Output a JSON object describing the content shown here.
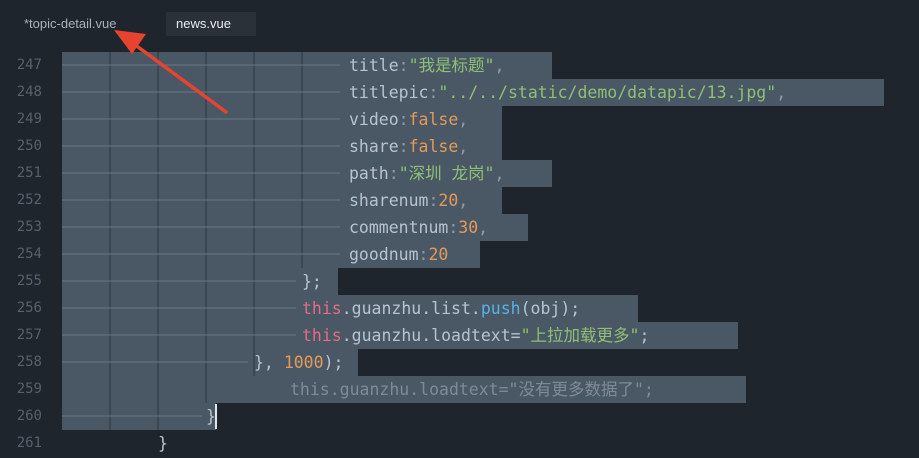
{
  "tabs": [
    {
      "label": "*topic-detail.vue",
      "active": false
    },
    {
      "label": "news.vue",
      "active": true
    }
  ],
  "line_numbers": [
    "247",
    "248",
    "249",
    "250",
    "251",
    "252",
    "253",
    "254",
    "255",
    "256",
    "257",
    "258",
    "259",
    "260",
    "261"
  ],
  "code": {
    "l247": {
      "key": "title",
      "colon": ":",
      "str": "\"我是标题\"",
      "end": ","
    },
    "l248": {
      "key": "titlepic",
      "colon": ":",
      "str": "\"../../static/demo/datapic/13.jpg\"",
      "end": ","
    },
    "l249": {
      "key": "video",
      "colon": ":",
      "val": "false",
      "end": ","
    },
    "l250": {
      "key": "share",
      "colon": ":",
      "val": "false",
      "end": ","
    },
    "l251": {
      "key": "path",
      "colon": ":",
      "str": "\"深圳 龙岗\"",
      "end": ","
    },
    "l252": {
      "key": "sharenum",
      "colon": ":",
      "val": "20",
      "end": ","
    },
    "l253": {
      "key": "commentnum",
      "colon": ":",
      "val": "30",
      "end": ","
    },
    "l254": {
      "key": "goodnum",
      "colon": ":",
      "val": "20"
    },
    "l255": {
      "text": "};"
    },
    "l256": {
      "this": "this",
      "rest1": ".guanzhu.list.",
      "fn": "push",
      "rest2": "(obj);"
    },
    "l257": {
      "this": "this",
      "rest1": ".guanzhu.loadtext=",
      "str": "\"上拉加载更多\"",
      "end": ";"
    },
    "l258": {
      "pre": "}, ",
      "num": "1000",
      "end": ");"
    },
    "l259": {
      "text": "this.guanzhu.loadtext=\"没有更多数据了\";"
    },
    "l260": {
      "text": "}"
    },
    "l261": {
      "text": "}"
    }
  },
  "colors": {
    "background": "#1e252c",
    "selection": "#4a5866",
    "string": "#8fbf74",
    "number": "#e39a56",
    "keyword": "#e56b86",
    "function": "#56b2e6",
    "arrow": "#e8432f"
  },
  "annotation": {
    "type": "red-arrow",
    "points_to": "tab-topic-detail"
  }
}
